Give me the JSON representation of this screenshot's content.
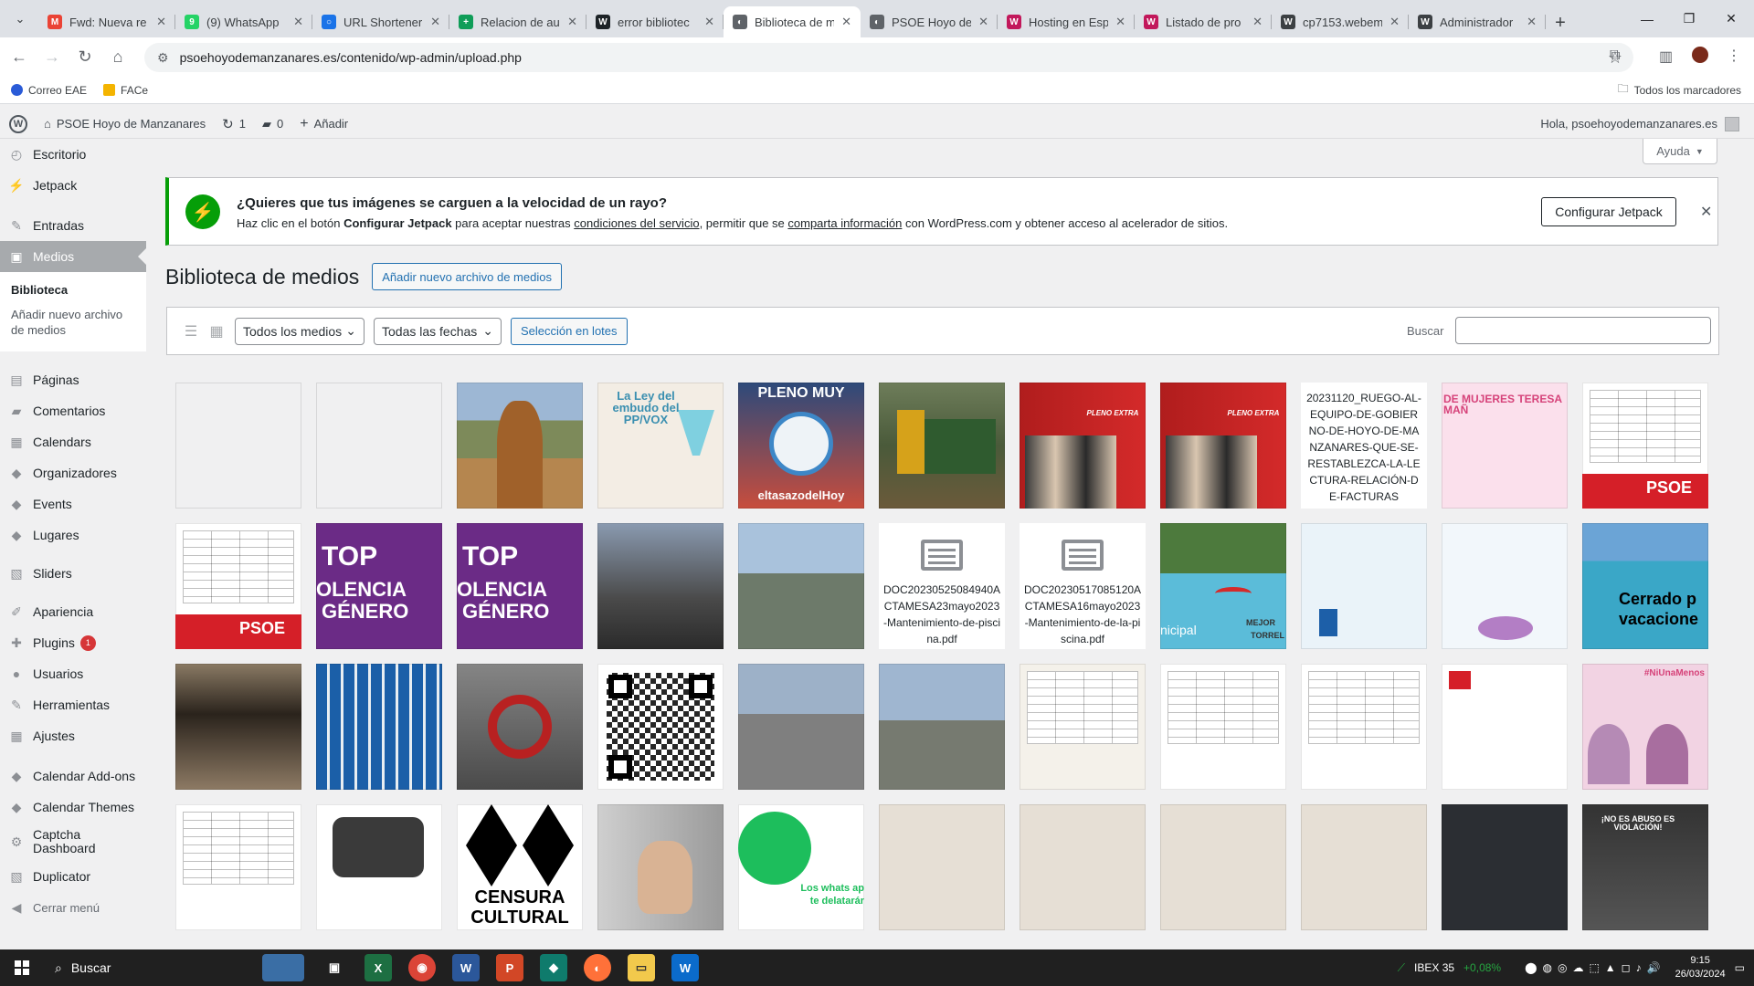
{
  "browser": {
    "tabs": [
      {
        "title": "Fwd: Nueva re",
        "fav_color": "#ea4335",
        "fav_glyph": "M"
      },
      {
        "title": "(9) WhatsApp",
        "fav_color": "#25d366",
        "fav_glyph": "9"
      },
      {
        "title": "URL Shortener",
        "fav_color": "#1a73e8",
        "fav_glyph": "○"
      },
      {
        "title": "Relacion de au",
        "fav_color": "#0f9d58",
        "fav_glyph": "+"
      },
      {
        "title": "error bibliotec",
        "fav_color": "#1d2327",
        "fav_glyph": "W"
      },
      {
        "title": "Biblioteca de m",
        "fav_color": "#5f6368",
        "fav_glyph": "◐",
        "active": true
      },
      {
        "title": "PSOE Hoyo de",
        "fav_color": "#5f6368",
        "fav_glyph": "◐"
      },
      {
        "title": "Hosting en Esp",
        "fav_color": "#c2185b",
        "fav_glyph": "W"
      },
      {
        "title": "Listado de pro",
        "fav_color": "#c2185b",
        "fav_glyph": "W"
      },
      {
        "title": "cp7153.webem",
        "fav_color": "#3c4043",
        "fav_glyph": "W"
      },
      {
        "title": "Administrador",
        "fav_color": "#3c4043",
        "fav_glyph": "W"
      }
    ],
    "url": "psoehoyodemanzanares.es/contenido/wp-admin/upload.php",
    "bookmarks": [
      {
        "label": "Correo EAE",
        "color": "#2a5bd7"
      },
      {
        "label": "FACe",
        "color": "#f4b400"
      }
    ],
    "all_bookmarks": "Todos los marcadores"
  },
  "adminbar": {
    "site_name": "PSOE Hoyo de Manzanares",
    "updates": "1",
    "comments": "0",
    "add_new": "Añadir",
    "greeting": "Hola, psoehoyodemanzanares.es"
  },
  "sidebar": {
    "items": [
      {
        "label": "Escritorio",
        "icon": "dashboard-icon"
      },
      {
        "label": "Jetpack",
        "icon": "jetpack-icon"
      },
      {
        "label": "Entradas",
        "icon": "pin-icon"
      },
      {
        "label": "Medios",
        "icon": "media-icon",
        "current": true
      },
      {
        "label": "Páginas",
        "icon": "page-icon"
      },
      {
        "label": "Comentarios",
        "icon": "comment-icon"
      },
      {
        "label": "Calendars",
        "icon": "calendar-icon"
      },
      {
        "label": "Organizadores",
        "icon": "organizer-icon"
      },
      {
        "label": "Events",
        "icon": "events-icon"
      },
      {
        "label": "Lugares",
        "icon": "location-icon"
      },
      {
        "label": "Sliders",
        "icon": "slider-icon"
      },
      {
        "label": "Apariencia",
        "icon": "brush-icon"
      },
      {
        "label": "Plugins",
        "icon": "plugin-icon",
        "badge": "1"
      },
      {
        "label": "Usuarios",
        "icon": "user-icon"
      },
      {
        "label": "Herramientas",
        "icon": "wrench-icon"
      },
      {
        "label": "Ajustes",
        "icon": "settings-icon"
      },
      {
        "label": "Calendar Add-ons",
        "icon": "addon-icon"
      },
      {
        "label": "Calendar Themes",
        "icon": "theme-icon"
      },
      {
        "label": "Captcha Dashboard",
        "icon": "gear-icon"
      },
      {
        "label": "Duplicator",
        "icon": "duplicator-icon"
      },
      {
        "label": "Cerrar menú",
        "icon": "collapse-icon"
      }
    ],
    "submenu": [
      "Biblioteca",
      "Añadir nuevo archivo de medios"
    ]
  },
  "help_tab": "Ayuda",
  "notice": {
    "title": "¿Quieres que tus imágenes se carguen a la velocidad de un rayo?",
    "body_1": "Haz clic en el botón ",
    "body_bold": "Configurar Jetpack",
    "body_2": " para aceptar nuestras ",
    "link_1": "condiciones del servicio",
    "body_3": ", permitir que se ",
    "link_2": "comparta información",
    "body_4": " con WordPress.com y obtener acceso al acelerador de sitios.",
    "button": "Configurar Jetpack"
  },
  "page": {
    "title": "Biblioteca de medios",
    "add_new": "Añadir nuevo archivo de medios"
  },
  "filters": {
    "media_type": "Todos los medios",
    "dates": "Todas las fechas",
    "bulk": "Selección en lotes",
    "search_label": "Buscar"
  },
  "grid": {
    "text_items": {
      "ruego": "20231120_RUEGO-AL-EQUIPO-DE-GOBIERNO-DE-HOYO-DE-MANZANARES-QUE-SE-RESTABLEZCA-LA-LECTURA-RELACIÓN-DE-FACTURAS",
      "doc1": "DOC20230525084940ACTAMESA23mayo2023-Mantenimiento-de-piscina.pdf",
      "doc2": "DOC20230517085120ACTAMESA16mayo2023-Mantenimiento-de-la-piscina.pdf"
    },
    "image_text": {
      "ley_pp_vox": "La Ley del embudo del PP/VOX",
      "pleno": "PLENO MUY",
      "pleno_sub": "eltasazodelHoy",
      "pleno_extra": "PLENO EXTRA",
      "mujeres": "DE MUJERES TERESA MAÑ",
      "psoe": "PSOE",
      "violencia_1": "TOP",
      "violencia_2": "OLENCIA",
      "violencia_3": "GÉNERO",
      "mejor": "MEJOR",
      "torrel": "TORREL",
      "nicipal": "nicipal",
      "cerrado_1": "Cerrado p",
      "cerrado_2": "vacacione",
      "nalamenos": "#NiUnaMenos",
      "censura_1": "CENSURA",
      "censura_2": "CULTURAL",
      "whatsapp_1": "Los whats ap",
      "whatsapp_2": "te delatarár",
      "no_abuso": "¡NO ES ABUSO ES VIOLACIÓN!"
    }
  },
  "taskbar": {
    "search": "Buscar",
    "ibex_label": "IBEX 35",
    "ibex_change": "+0,08%",
    "time": "9:15",
    "date": "26/03/2024"
  }
}
